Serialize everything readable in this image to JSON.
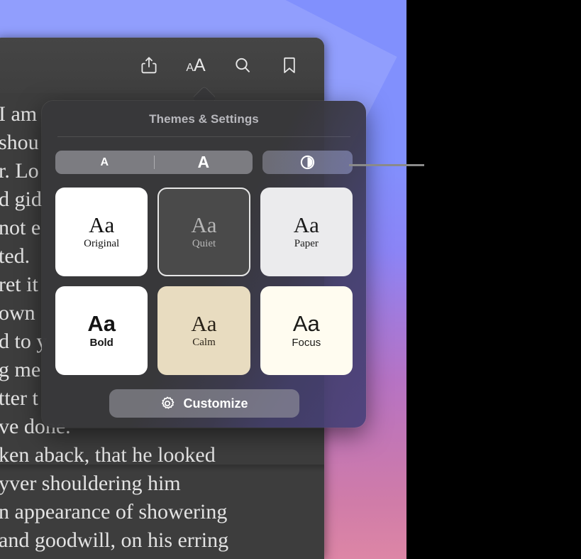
{
  "desktop": {
    "wallpaper_top_color": "#8190fd",
    "wallpaper_bottom_color": "#dd86a6",
    "backdrop_color": "#000000"
  },
  "reader_window": {
    "background_color": "#3d3d3d",
    "toolbar": {
      "buttons": [
        {
          "name": "share-icon",
          "label": "Share"
        },
        {
          "name": "text-size-icon",
          "label": "AA",
          "small_a": "A",
          "big_a": "A"
        },
        {
          "name": "search-icon",
          "label": "Search"
        },
        {
          "name": "bookmark-icon",
          "label": "Bookmark"
        }
      ]
    },
    "body_text_lines": [
      "I am",
      "shou",
      "r. Lo",
      "d gid",
      "not e",
      "ted.",
      "ret it",
      "own",
      "d to y",
      "g me",
      "tter t",
      "ve done.",
      "ken aback, that he looked",
      "yver shouldering him",
      "n appearance of showering",
      "and goodwill, on his erring"
    ]
  },
  "popover": {
    "title": "Themes & Settings",
    "controls": {
      "font_size_segment": {
        "name": "font-size-segmented-control",
        "decrease_label": "A",
        "increase_label": "A"
      },
      "contrast_toggle": {
        "name": "contrast-toggle-button",
        "icon": "contrast-circle-icon"
      }
    },
    "themes": [
      {
        "name": "Original",
        "sample": "Aa",
        "bg": "#ffffff",
        "fg": "#111111",
        "font": "serif",
        "weight": "normal",
        "selected": false
      },
      {
        "name": "Quiet",
        "sample": "Aa",
        "bg": "#4a4a4a",
        "fg": "#b6b6b6",
        "font": "serif",
        "weight": "normal",
        "selected": true
      },
      {
        "name": "Paper",
        "sample": "Aa",
        "bg": "#ebebed",
        "fg": "#1b1b1b",
        "font": "serif",
        "weight": "normal",
        "selected": false
      },
      {
        "name": "Bold",
        "sample": "Aa",
        "bg": "#ffffff",
        "fg": "#141414",
        "font": "sans",
        "weight": "bold",
        "selected": false
      },
      {
        "name": "Calm",
        "sample": "Aa",
        "bg": "#e8dcc0",
        "fg": "#2a2318",
        "font": "serif",
        "weight": "normal",
        "selected": false
      },
      {
        "name": "Focus",
        "sample": "Aa",
        "bg": "#fffcf0",
        "fg": "#1b1b18",
        "font": "sans",
        "weight": "normal",
        "selected": false
      }
    ],
    "customize_button": {
      "label": "Customize",
      "icon": "gear-icon"
    }
  },
  "annotation": {
    "callout_line_color": "#8a8a8a"
  }
}
